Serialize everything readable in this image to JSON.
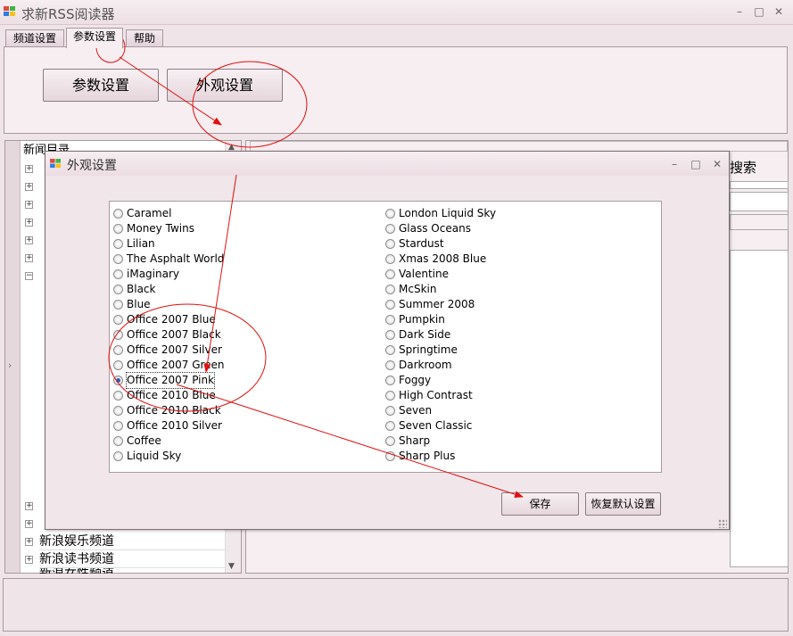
{
  "app": {
    "title": "求新RSS阅读器",
    "icon": "app-windows-icon",
    "window_buttons": {
      "minimize": "–",
      "maximize": "□",
      "close": "✕"
    }
  },
  "tabs": [
    {
      "label": "频道设置"
    },
    {
      "label": "参数设置"
    },
    {
      "label": "帮助"
    }
  ],
  "params_panel": {
    "params_button": "参数设置",
    "appearance_button": "外观设置"
  },
  "tree": {
    "header": "新闻目录",
    "items": [
      {
        "label": "新浪娱乐频道"
      },
      {
        "label": "新浪读书频道"
      },
      {
        "label": "新浪女性频道"
      }
    ]
  },
  "right_panel": {
    "search_label": "搜索"
  },
  "dialog": {
    "title": "外观设置",
    "window_buttons": {
      "minimize": "–",
      "maximize": "□",
      "close": "✕"
    },
    "skins_left": [
      {
        "label": "Caramel",
        "checked": false
      },
      {
        "label": "Money Twins",
        "checked": false
      },
      {
        "label": "Lilian",
        "checked": false
      },
      {
        "label": "The Asphalt World",
        "checked": false
      },
      {
        "label": "iMaginary",
        "checked": false
      },
      {
        "label": "Black",
        "checked": false
      },
      {
        "label": "Blue",
        "checked": false
      },
      {
        "label": "Office 2007 Blue",
        "checked": false
      },
      {
        "label": "Office 2007 Black",
        "checked": false
      },
      {
        "label": "Office 2007 Silver",
        "checked": false
      },
      {
        "label": "Office 2007 Green",
        "checked": false
      },
      {
        "label": "Office 2007 Pink",
        "checked": true
      },
      {
        "label": "Office 2010 Blue",
        "checked": false
      },
      {
        "label": "Office 2010 Black",
        "checked": false
      },
      {
        "label": "Office 2010 Silver",
        "checked": false
      },
      {
        "label": "Coffee",
        "checked": false
      },
      {
        "label": "Liquid Sky",
        "checked": false
      }
    ],
    "skins_right": [
      {
        "label": "London Liquid Sky",
        "checked": false
      },
      {
        "label": "Glass Oceans",
        "checked": false
      },
      {
        "label": "Stardust",
        "checked": false
      },
      {
        "label": "Xmas 2008 Blue",
        "checked": false
      },
      {
        "label": "Valentine",
        "checked": false
      },
      {
        "label": "McSkin",
        "checked": false
      },
      {
        "label": "Summer 2008",
        "checked": false
      },
      {
        "label": "Pumpkin",
        "checked": false
      },
      {
        "label": "Dark Side",
        "checked": false
      },
      {
        "label": "Springtime",
        "checked": false
      },
      {
        "label": "Darkroom",
        "checked": false
      },
      {
        "label": "Foggy",
        "checked": false
      },
      {
        "label": "High Contrast",
        "checked": false
      },
      {
        "label": "Seven",
        "checked": false
      },
      {
        "label": "Seven Classic",
        "checked": false
      },
      {
        "label": "Sharp",
        "checked": false
      },
      {
        "label": "Sharp Plus",
        "checked": false
      }
    ],
    "save_button": "保存",
    "reset_button": "恢复默认设置"
  },
  "annotation_color": "#e01010"
}
